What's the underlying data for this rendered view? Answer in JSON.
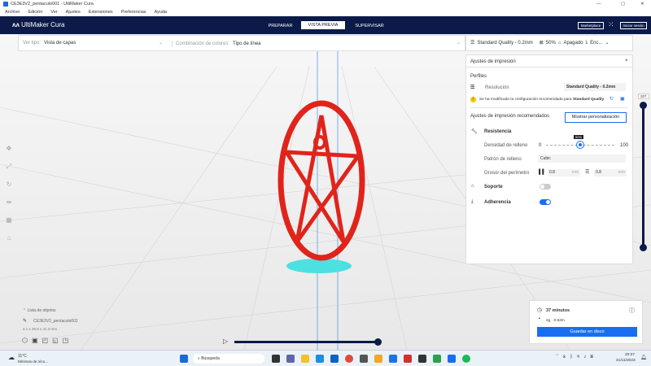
{
  "window": {
    "title": "CE3E3V2_pentaculo001 - UltiMaker Cura"
  },
  "menu": [
    "Archivo",
    "Edición",
    "Ver",
    "Ajustes",
    "Extensiones",
    "Preferencias",
    "Ayuda"
  ],
  "header": {
    "brand": "UltiMaker Cura",
    "tabs": [
      "PREPARAR",
      "VISTA PREVIA",
      "SUPERVISAR"
    ],
    "active_tab": "VISTA PREVIA",
    "marketplace": "Marketplace",
    "signin": "Iniciar sesión"
  },
  "viewbar": {
    "view_label": "Ver tipo:",
    "view_value": "Vista de capas",
    "color_label": "Combinación de colores:",
    "color_value": "Tipo de línea"
  },
  "quickbar": {
    "profile": "Standard Quality - 0.2mm",
    "infill": "50%",
    "support": "Apagado",
    "adhesion": "Enc..."
  },
  "settings": {
    "title": "Ajustes de impresión",
    "profiles": "Perfiles",
    "resolution_label": "Resolución",
    "resolution_value": "Standard Quality - 0.2mm",
    "warning_text": "Se ha modificado la configuración recomendada para ",
    "warning_bold": "Standard Quality",
    "recommended": "Ajustes de impresión recomendados",
    "custom_button": "Mostrar personalización",
    "strength": "Resistencia",
    "infill_density_label": "Densidad de relleno",
    "infill_min": "0",
    "infill_max": "100",
    "infill_value": "50%",
    "infill_fraction": 0.5,
    "infill_pattern_label": "Patrón de relleno",
    "infill_pattern": "Cubic",
    "wall_label": "Grosor del perímetro",
    "wall_value": "0.8",
    "wall_unit": "mm",
    "top_value": "0.8",
    "top_unit": "mm",
    "support": "Soporte",
    "support_on": false,
    "adhesion": "Adherencia",
    "adhesion_on": true
  },
  "layer_slider": {
    "value": "207"
  },
  "objects": {
    "header": "Lista de objetos",
    "name": "CE3E3V2_pentaculo001",
    "dims": "4.1 x 36.8 x 41.3 mm"
  },
  "print": {
    "time": "37 minutos",
    "material": "2g · 0.52m",
    "save": "Guardar en disco"
  },
  "taskbar": {
    "weather_temp": "11°C",
    "weather_text": "Mínimas de réco...",
    "search": "Búsqueda",
    "time": "20:37",
    "date": "21/11/2023"
  },
  "colors": {
    "navy": "#0b1a48",
    "accent": "#196ef0",
    "model": "#e0241b",
    "skirt": "#4de0e0"
  }
}
